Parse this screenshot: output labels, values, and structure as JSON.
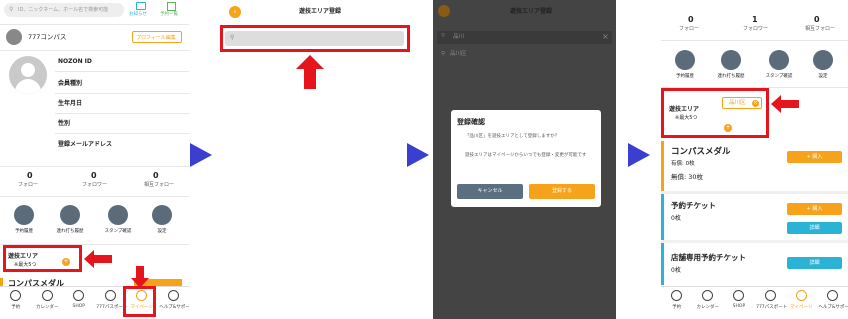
{
  "p1": {
    "search_placeholder": "ID、ニックネーム、ホール名で検索可能",
    "notice_label": "お知らせ",
    "reserve_list_label": "予約一覧",
    "user_name": "777コンパス",
    "edit_profile": "プロフィール編集",
    "fields": [
      "NOZON ID",
      "会員種別",
      "生年月日",
      "性別",
      "登録メールアドレス"
    ],
    "stats": [
      {
        "value": "0",
        "label": "フォロー"
      },
      {
        "value": "0",
        "label": "フォロワー"
      },
      {
        "value": "0",
        "label": "相互フォロー"
      }
    ],
    "menu": [
      "予約履歴",
      "連れ打ち履歴",
      "スタンプ確認",
      "設定"
    ],
    "area_title": "遊技エリア",
    "area_note": "※最大5つ",
    "partial_text": "コンパスメダル",
    "nav": [
      "予約",
      "カレンダー",
      "SHOP",
      "777パスポート",
      "マイページ",
      "ヘルプ&サポート"
    ]
  },
  "p2": {
    "title": "遊技エリア登録"
  },
  "p3": {
    "title": "遊技エリア登録",
    "search_value": "品川",
    "list_item": "品川区",
    "dialog_title": "登録確認",
    "dialog_msg1": "「品川区」を遊技エリアとして登録しますか？",
    "dialog_msg2": "遊技エリアはマイページからいつでも登録・変更が可能です",
    "cancel": "キャンセル",
    "confirm": "登録する"
  },
  "p4": {
    "stats": [
      {
        "value": "0",
        "label": "フォロー"
      },
      {
        "value": "1",
        "label": "フォロワー"
      },
      {
        "value": "0",
        "label": "相互フォロー"
      }
    ],
    "menu": [
      "予約履歴",
      "連れ打ち履歴",
      "スタンプ確認",
      "設定"
    ],
    "area_title": "遊技エリア",
    "area_note": "※最大5つ",
    "area_tag": "品川区",
    "medal_title": "コンパスメダル",
    "medal_owned": "有償: 0枚",
    "medal_free": "無償: 30枚",
    "ticket_title": "予約チケット",
    "ticket_count": "0枚",
    "store_ticket_title": "店舗専用予約チケット",
    "store_ticket_count": "0枚",
    "buy": "+ 購入",
    "detail": "詳細",
    "nav": [
      "予約",
      "カレンダー",
      "SHOP",
      "777パスポート",
      "マイページ",
      "ヘルプ&サポート"
    ]
  },
  "colors": {
    "accent": "#f7a21b",
    "red_highlight": "#e5141d",
    "blue_arrow": "#3a3fd0",
    "detail_blue": "#2bb3d6",
    "card_bar": "#2bb3d6"
  }
}
